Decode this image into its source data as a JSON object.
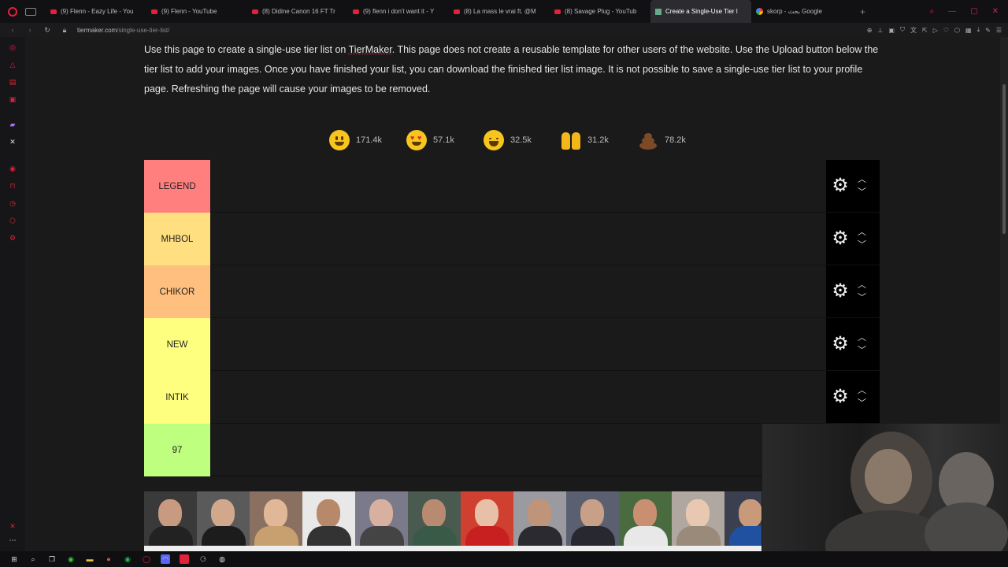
{
  "browser": {
    "tabs": [
      {
        "label": "(9) Flenn - Eazy Life - You",
        "kind": "yt"
      },
      {
        "label": "(9) Flenn - YouTube",
        "kind": "yt"
      },
      {
        "label": "(8) Didine Canon 16 FT Tr",
        "kind": "yt"
      },
      {
        "label": "(9) flenn i don't want it - Y",
        "kind": "yt"
      },
      {
        "label": "(8) La mass le vrai ft. @M",
        "kind": "yt"
      },
      {
        "label": "(8) Savage Plug - YouTub",
        "kind": "yt"
      },
      {
        "label": "Create a Single-Use Tier l",
        "kind": "tm",
        "active": true
      },
      {
        "label": "skorp - بحث Google",
        "kind": "g"
      }
    ],
    "new_tab": "+",
    "url_host": "tiermaker.com",
    "url_path": "/single-use-tier-list/"
  },
  "page": {
    "intro_part1": "Use this page to create a single-use tier list on ",
    "intro_link": "TierMaker",
    "intro_part2": ". This page does not create a reusable template for other users of the website. Use the Upload button below the tier list to add your images. Once you have finished your list, you can download the finished tier list image. It is not possible to save a single-use tier list to your profile page. Refreshing the page will cause your images to be removed.",
    "reactions": [
      {
        "icon": "smile-emoji-icon",
        "count": "171.4k"
      },
      {
        "icon": "heart-eyes-emoji-icon",
        "count": "57.1k"
      },
      {
        "icon": "laughing-emoji-icon",
        "count": "32.5k"
      },
      {
        "icon": "raised-hands-emoji-icon",
        "count": "31.2k"
      },
      {
        "icon": "poop-emoji-icon",
        "count": "78.2k"
      }
    ],
    "tiers": [
      {
        "label": "LEGEND",
        "color": "#ff7f7f"
      },
      {
        "label": "MHBOL",
        "color": "#ffdf80"
      },
      {
        "label": "CHIKOR",
        "color": "#ffbf7f"
      },
      {
        "label": "NEW",
        "color": "#ffff7f"
      },
      {
        "label": "INTIK",
        "color": "#ffff7f"
      },
      {
        "label": "97",
        "color": "#bfff7f"
      }
    ]
  },
  "colors": {
    "accent": "#e0223a",
    "background": "#1a1a1a",
    "tier_controls": "#000000"
  }
}
